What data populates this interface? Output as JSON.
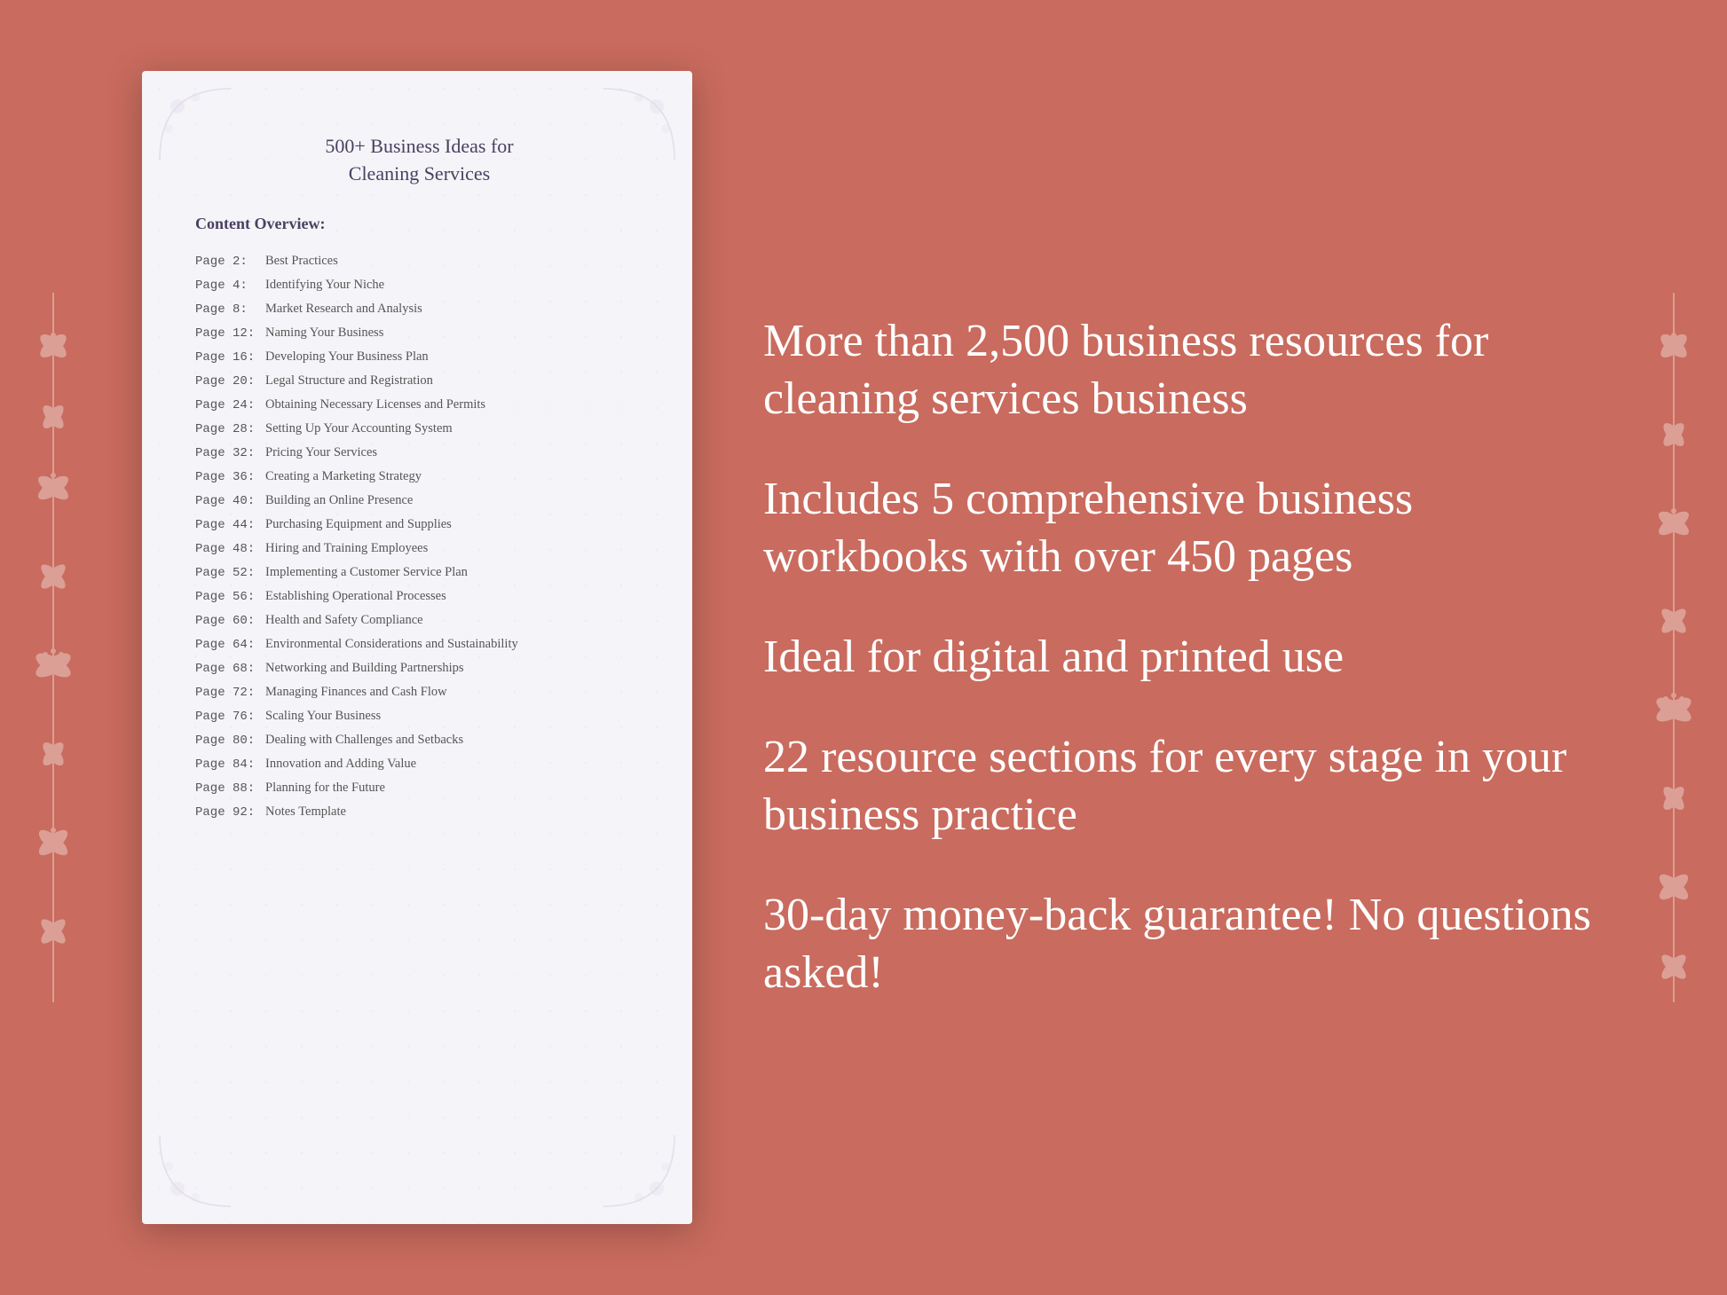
{
  "background_color": "#c96b5e",
  "document": {
    "title_line1": "500+ Business Ideas for",
    "title_line2": "Cleaning Services",
    "section_label": "Content Overview:",
    "toc_items": [
      {
        "page": "Page  2:",
        "title": "Best Practices"
      },
      {
        "page": "Page  4:",
        "title": "Identifying Your Niche"
      },
      {
        "page": "Page  8:",
        "title": "Market Research and Analysis"
      },
      {
        "page": "Page 12:",
        "title": "Naming Your Business"
      },
      {
        "page": "Page 16:",
        "title": "Developing Your Business Plan"
      },
      {
        "page": "Page 20:",
        "title": "Legal Structure and Registration"
      },
      {
        "page": "Page 24:",
        "title": "Obtaining Necessary Licenses and Permits"
      },
      {
        "page": "Page 28:",
        "title": "Setting Up Your Accounting System"
      },
      {
        "page": "Page 32:",
        "title": "Pricing Your Services"
      },
      {
        "page": "Page 36:",
        "title": "Creating a Marketing Strategy"
      },
      {
        "page": "Page 40:",
        "title": "Building an Online Presence"
      },
      {
        "page": "Page 44:",
        "title": "Purchasing Equipment and Supplies"
      },
      {
        "page": "Page 48:",
        "title": "Hiring and Training Employees"
      },
      {
        "page": "Page 52:",
        "title": "Implementing a Customer Service Plan"
      },
      {
        "page": "Page 56:",
        "title": "Establishing Operational Processes"
      },
      {
        "page": "Page 60:",
        "title": "Health and Safety Compliance"
      },
      {
        "page": "Page 64:",
        "title": "Environmental Considerations and Sustainability"
      },
      {
        "page": "Page 68:",
        "title": "Networking and Building Partnerships"
      },
      {
        "page": "Page 72:",
        "title": "Managing Finances and Cash Flow"
      },
      {
        "page": "Page 76:",
        "title": "Scaling Your Business"
      },
      {
        "page": "Page 80:",
        "title": "Dealing with Challenges and Setbacks"
      },
      {
        "page": "Page 84:",
        "title": "Innovation and Adding Value"
      },
      {
        "page": "Page 88:",
        "title": "Planning for the Future"
      },
      {
        "page": "Page 92:",
        "title": "Notes Template"
      }
    ]
  },
  "features": [
    "More than 2,500 business resources for cleaning services business",
    "Includes 5 comprehensive business workbooks with over 450 pages",
    "Ideal for digital and printed use",
    "22 resource sections for every stage in your business practice",
    "30-day money-back guarantee! No questions asked!"
  ]
}
